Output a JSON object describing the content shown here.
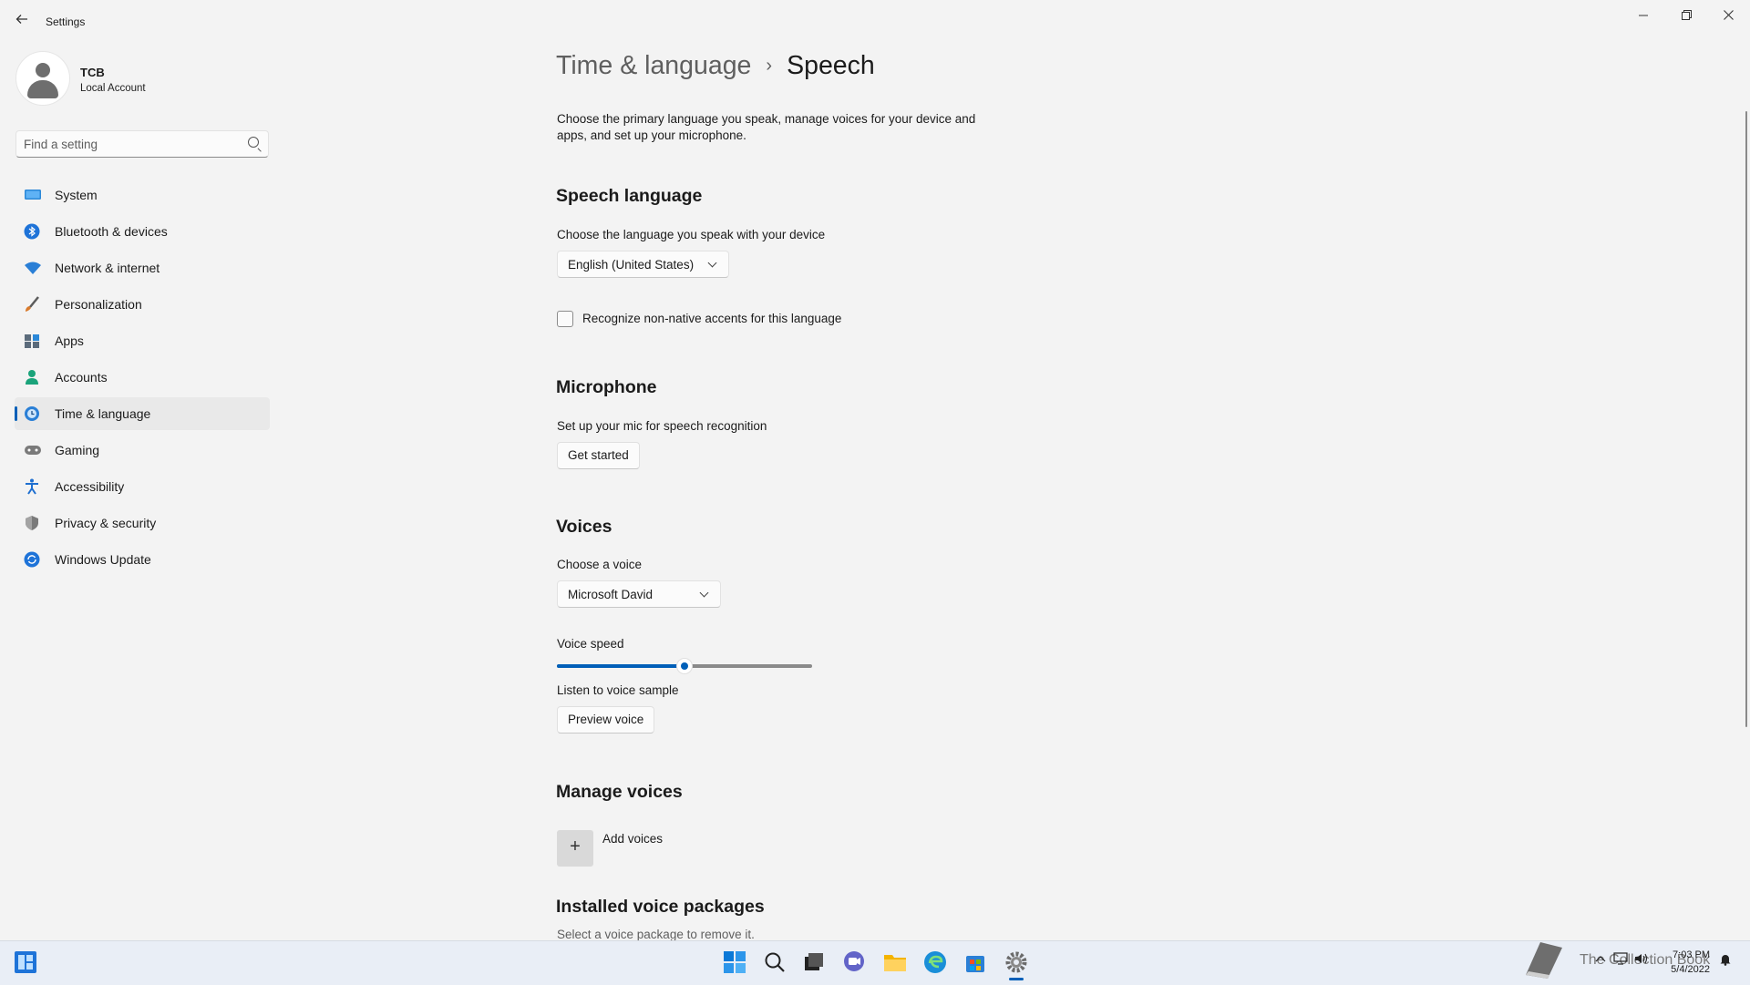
{
  "window": {
    "title": "Settings"
  },
  "profile": {
    "name": "TCB",
    "account_type": "Local Account"
  },
  "search": {
    "placeholder": "Find a setting"
  },
  "nav": {
    "items": [
      {
        "label": "System",
        "icon": "system-icon",
        "color": "#2b88d8"
      },
      {
        "label": "Bluetooth & devices",
        "icon": "bluetooth-icon",
        "color": "#1e73d8"
      },
      {
        "label": "Network & internet",
        "icon": "wifi-icon",
        "color": "#2a7fd6"
      },
      {
        "label": "Personalization",
        "icon": "brush-icon",
        "color": "#d97a2b"
      },
      {
        "label": "Apps",
        "icon": "apps-icon",
        "color": "#5b6b7b"
      },
      {
        "label": "Accounts",
        "icon": "accounts-icon",
        "color": "#1aa37a"
      },
      {
        "label": "Time & language",
        "icon": "globe-clock-icon",
        "color": "#2a7fd6",
        "selected": true
      },
      {
        "label": "Gaming",
        "icon": "gamepad-icon",
        "color": "#6b6b6b"
      },
      {
        "label": "Accessibility",
        "icon": "accessibility-icon",
        "color": "#1e6fd0"
      },
      {
        "label": "Privacy & security",
        "icon": "shield-icon",
        "color": "#707070"
      },
      {
        "label": "Windows Update",
        "icon": "update-icon",
        "color": "#1e73d8"
      }
    ]
  },
  "breadcrumb": {
    "parent": "Time & language",
    "separator": "›",
    "current": "Speech"
  },
  "description": "Choose the primary language you speak, manage voices for your device and apps, and set up your microphone.",
  "speech_language": {
    "title": "Speech language",
    "prompt": "Choose the language you speak with your device",
    "selected": "English (United States)",
    "checkbox_label": "Recognize non-native accents for this language",
    "checkbox_checked": false
  },
  "microphone": {
    "title": "Microphone",
    "prompt": "Set up your mic for speech recognition",
    "button": "Get started"
  },
  "voices": {
    "title": "Voices",
    "choose_label": "Choose a voice",
    "selected_voice": "Microsoft David",
    "speed_label": "Voice speed",
    "speed_fraction": 0.5,
    "sample_label": "Listen to voice sample",
    "preview_button": "Preview voice"
  },
  "manage_voices": {
    "title": "Manage voices",
    "add_label": "Add voices",
    "add_symbol": "+"
  },
  "installed": {
    "title": "Installed voice packages",
    "hint": "Select a voice package to remove it."
  },
  "taskbar": {
    "time": "7:03 PM",
    "date": "5/4/2022",
    "accent": "#005fb8"
  },
  "watermark": {
    "text": "The Collection Book"
  }
}
